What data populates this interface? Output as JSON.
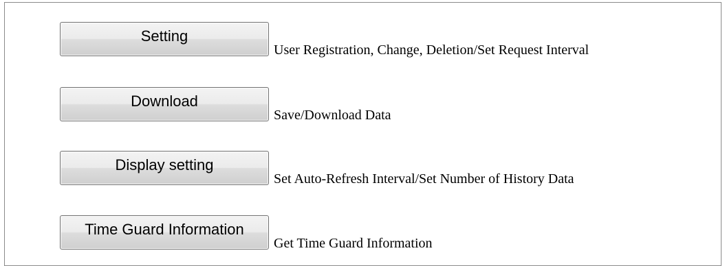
{
  "menu": {
    "items": [
      {
        "button_label": "Setting",
        "description": "User Registration, Change, Deletion/Set Request Interval"
      },
      {
        "button_label": "Download",
        "description": "Save/Download Data"
      },
      {
        "button_label": "Display setting",
        "description": "Set Auto-Refresh Interval/Set Number of History Data"
      },
      {
        "button_label": "Time Guard Information",
        "description": "Get Time Guard Information"
      }
    ]
  }
}
